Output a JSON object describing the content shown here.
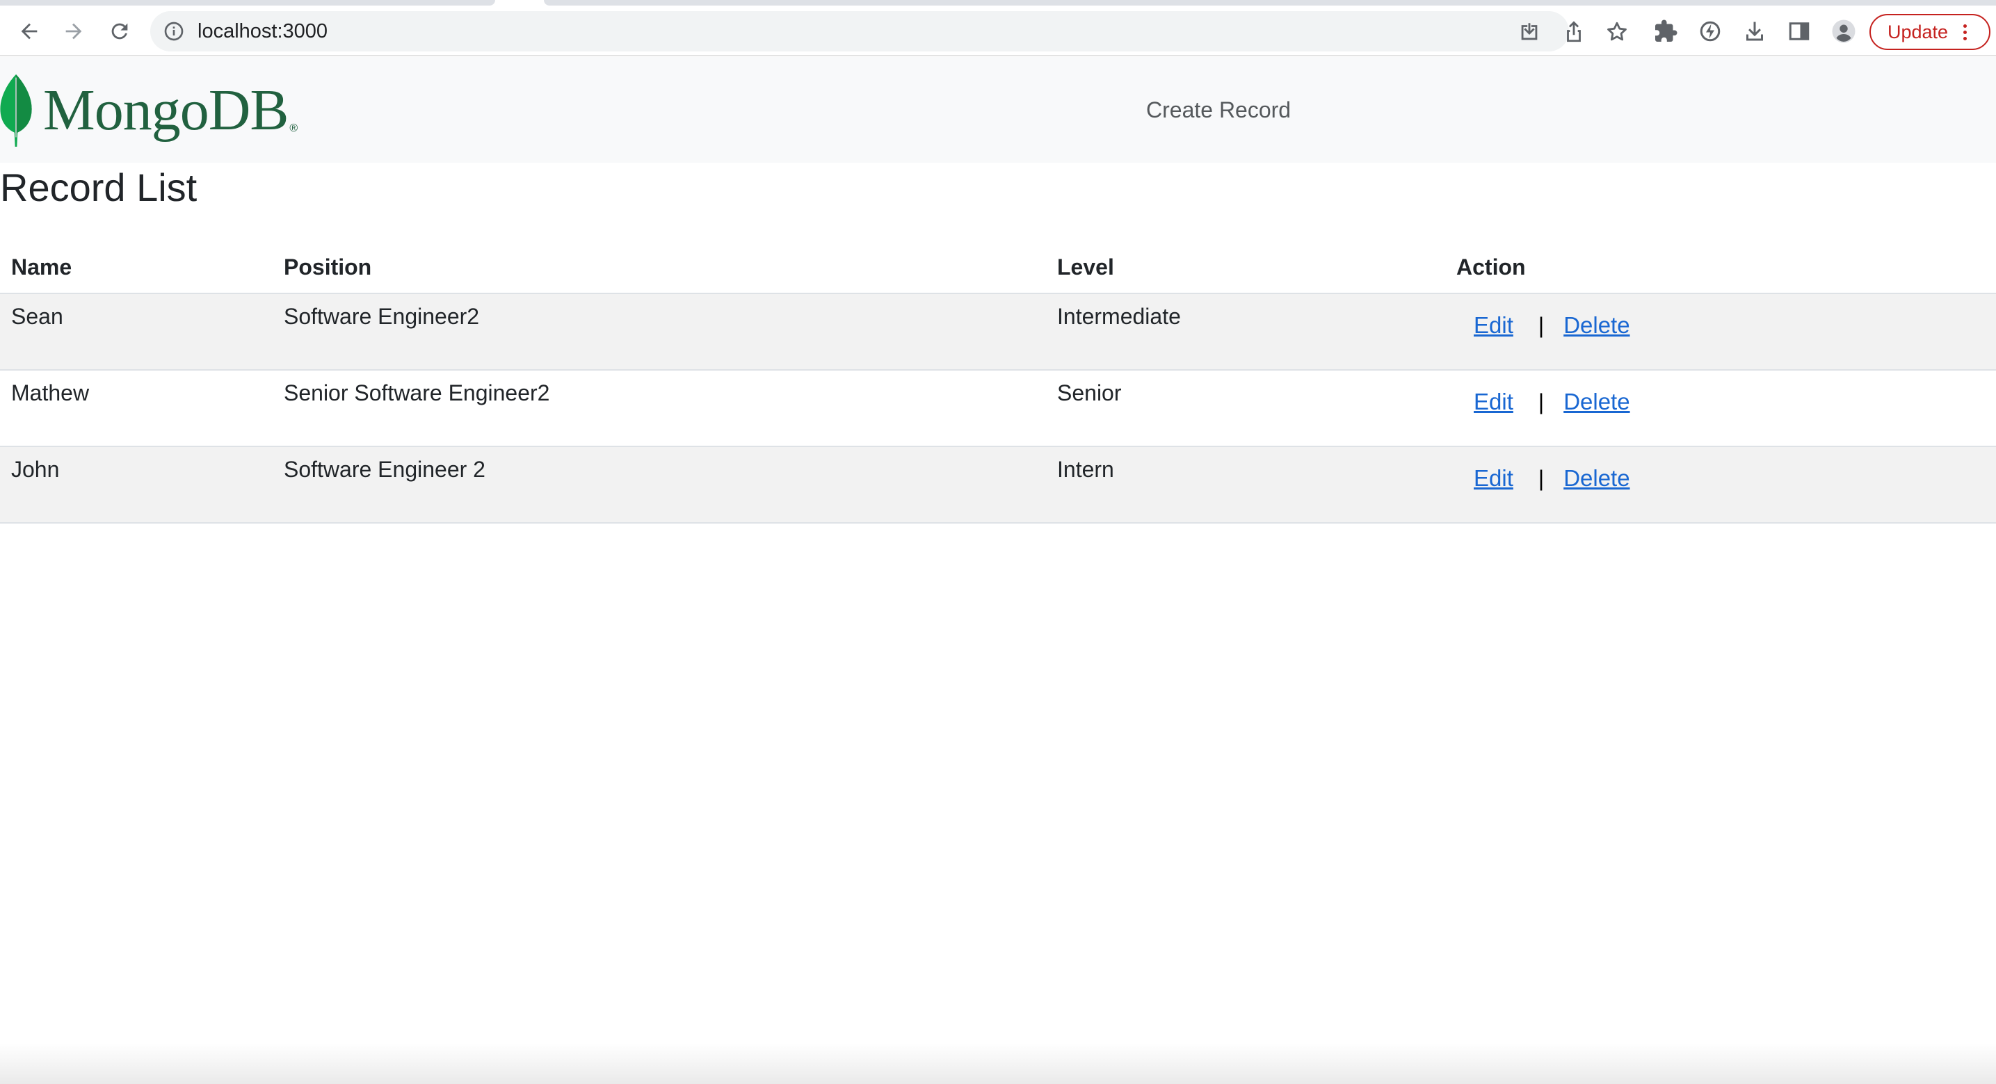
{
  "browser": {
    "url": "localhost:3000",
    "update_label": "Update"
  },
  "navbar": {
    "brand": "MongoDB",
    "brand_mark": "®",
    "create_link": "Create Record"
  },
  "page": {
    "title": "Record List"
  },
  "table": {
    "headers": [
      "Name",
      "Position",
      "Level",
      "Action"
    ],
    "rows": [
      {
        "name": "Sean",
        "position": "Software Engineer2",
        "level": "Intermediate",
        "edit": "Edit",
        "separator": "|",
        "delete": "Delete"
      },
      {
        "name": "Mathew",
        "position": "Senior Software Engineer2",
        "level": "Senior",
        "edit": "Edit",
        "separator": "|",
        "delete": "Delete"
      },
      {
        "name": "John",
        "position": "Software Engineer 2",
        "level": "Intern",
        "edit": "Edit",
        "separator": "|",
        "delete": "Delete"
      }
    ]
  },
  "colors": {
    "brand_green": "#21613f",
    "link_blue": "#1967d2",
    "update_red": "#c5221f",
    "stripe": "#f2f2f2"
  }
}
